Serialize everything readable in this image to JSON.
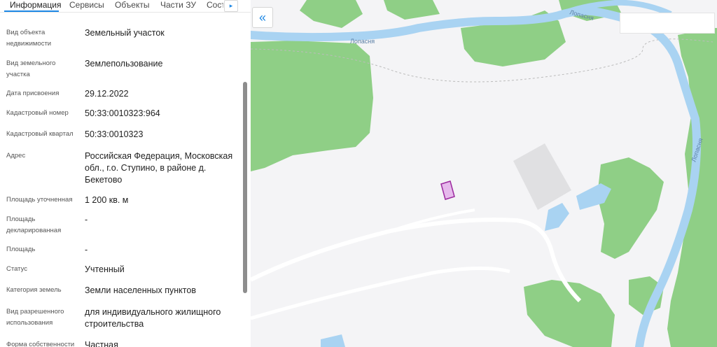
{
  "tabs": [
    {
      "label": "Информация",
      "active": true
    },
    {
      "label": "Сервисы",
      "active": false
    },
    {
      "label": "Объекты",
      "active": false
    },
    {
      "label": "Части ЗУ",
      "active": false
    },
    {
      "label": "Соста",
      "active": false
    }
  ],
  "tab_next_icon": "▸",
  "collapse_icon": "«",
  "properties": [
    {
      "label": "Вид объекта недвижимости",
      "value": "Земельный участок"
    },
    {
      "label": "Вид земельного участка",
      "value": "Землепользование"
    },
    {
      "label": "Дата присвоения",
      "value": "29.12.2022"
    },
    {
      "label": "Кадастровый номер",
      "value": "50:33:0010323:964"
    },
    {
      "label": "Кадастровый квартал",
      "value": "50:33:0010323"
    },
    {
      "label": "Адрес",
      "value": "Российская Федерация, Московская обл., г.о. Ступино, в районе д. Бекетово"
    },
    {
      "label": "Площадь уточненная",
      "value": "1 200 кв. м"
    },
    {
      "label": "Площадь декларированная",
      "value": "-"
    },
    {
      "label": "Площадь",
      "value": "-"
    },
    {
      "label": "Статус",
      "value": "Учтенный"
    },
    {
      "label": "Категория земель",
      "value": "Земли населенных пунктов"
    },
    {
      "label": "Вид разрешенного использования",
      "value": "для индивидуального жилищного строительства"
    },
    {
      "label": "Форма собственности",
      "value": "Частная"
    }
  ],
  "map": {
    "river_label": "Лопасня",
    "colors": {
      "background": "#f4f4f6",
      "forest": "#8fcf86",
      "water": "#a9d3f2",
      "parcel_fill": "#e6b9ec",
      "parcel_stroke": "#9c2a9f",
      "road": "#ffffff",
      "building": "#e0e0e2"
    }
  }
}
